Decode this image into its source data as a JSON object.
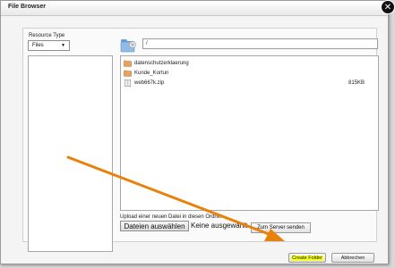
{
  "dialog": {
    "title": "File Browser"
  },
  "resource_type": {
    "label": "Resource Type",
    "selected": "Files"
  },
  "path": {
    "value": "/"
  },
  "files": [
    {
      "name": "datenschutzerklaerung",
      "kind": "folder",
      "size": ""
    },
    {
      "name": "Kunde_Kortun",
      "kind": "folder",
      "size": ""
    },
    {
      "name": "web667k.zip",
      "kind": "file",
      "size": "815KB"
    }
  ],
  "upload": {
    "label": "Upload einer neuen Datei in diesen Ordner",
    "choose_button": "Dateien auswählen",
    "no_file_text": "Keine ausgewählt",
    "send_button": "Zum Server senden"
  },
  "footer": {
    "create_folder": "Create Folder",
    "cancel": "Abbrechen"
  },
  "colors": {
    "highlight": "#f7ff2a",
    "annotation_arrow": "#e8820c"
  },
  "icons": {
    "close": "close-icon",
    "folder": "folder-icon",
    "file": "file-icon"
  }
}
